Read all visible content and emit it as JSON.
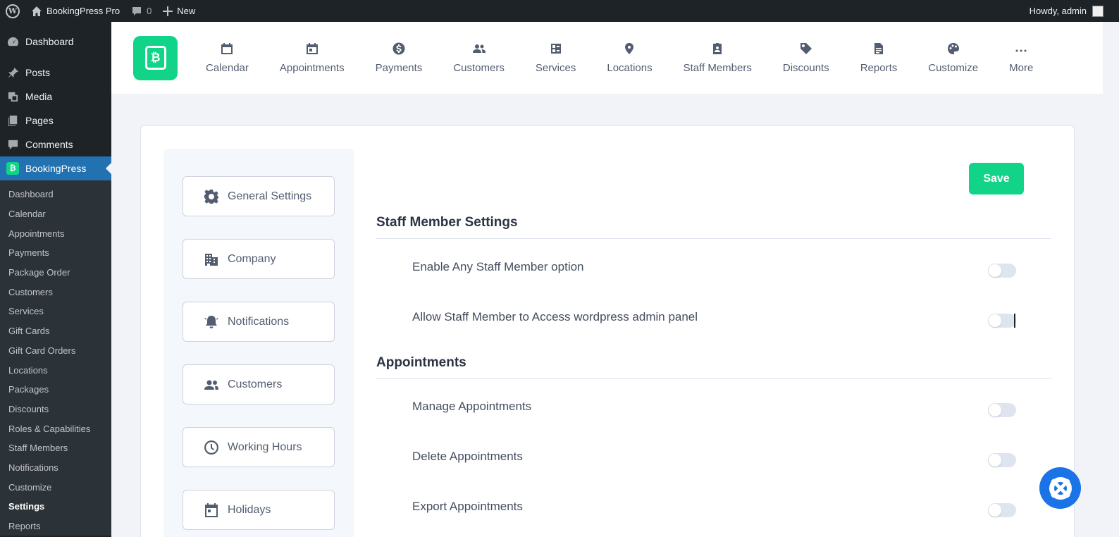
{
  "adminbar": {
    "site_name": "BookingPress Pro",
    "comments_count": "0",
    "new_label": "New",
    "howdy": "Howdy, admin"
  },
  "wp_menu": {
    "top_items": [
      {
        "label": "Dashboard",
        "icon": "dashboard-icon"
      },
      {
        "label": "Posts",
        "icon": "pin-icon"
      },
      {
        "label": "Media",
        "icon": "media-icon"
      },
      {
        "label": "Pages",
        "icon": "pages-icon"
      },
      {
        "label": "Comments",
        "icon": "comment-icon"
      }
    ],
    "current": {
      "label": "BookingPress",
      "icon": "bookingpress-icon"
    },
    "sub_items": [
      "Dashboard",
      "Calendar",
      "Appointments",
      "Payments",
      "Package Order",
      "Customers",
      "Services",
      "Gift Cards",
      "Gift Card Orders",
      "Locations",
      "Packages",
      "Discounts",
      "Roles & Capabilities",
      "Staff Members",
      "Notifications",
      "Customize",
      "Settings",
      "Reports"
    ],
    "active_sub": "Settings"
  },
  "bp_nav": {
    "items": [
      {
        "label": "Calendar",
        "icon": "calendar-icon"
      },
      {
        "label": "Appointments",
        "icon": "appointments-icon"
      },
      {
        "label": "Payments",
        "icon": "dollar-icon"
      },
      {
        "label": "Customers",
        "icon": "users-icon"
      },
      {
        "label": "Services",
        "icon": "services-icon"
      },
      {
        "label": "Locations",
        "icon": "location-pin-icon"
      },
      {
        "label": "Staff Members",
        "icon": "staff-badge-icon"
      },
      {
        "label": "Discounts",
        "icon": "tag-icon"
      },
      {
        "label": "Reports",
        "icon": "report-icon"
      },
      {
        "label": "Customize",
        "icon": "palette-icon"
      },
      {
        "label": "More",
        "icon": "more-dots-icon"
      }
    ]
  },
  "settings_menu": {
    "items": [
      {
        "label": "General Settings",
        "icon": "gear-icon"
      },
      {
        "label": "Company",
        "icon": "building-icon"
      },
      {
        "label": "Notifications",
        "icon": "bell-icon"
      },
      {
        "label": "Customers",
        "icon": "users-icon"
      },
      {
        "label": "Working Hours",
        "icon": "clock-icon"
      },
      {
        "label": "Holidays",
        "icon": "calendar-icon"
      }
    ]
  },
  "content": {
    "save_label": "Save",
    "sections": [
      {
        "title": "Staff Member Settings",
        "settings": [
          {
            "label": "Enable Any Staff Member option",
            "enabled": false
          },
          {
            "label": "Allow Staff Member to Access wordpress admin panel",
            "enabled": false
          }
        ]
      },
      {
        "title": "Appointments",
        "settings": [
          {
            "label": "Manage Appointments",
            "enabled": false
          },
          {
            "label": "Delete Appointments",
            "enabled": false
          },
          {
            "label": "Export Appointments",
            "enabled": false
          }
        ]
      }
    ]
  },
  "colors": {
    "brand_green": "#12d488",
    "wp_dark": "#1d2327",
    "wp_blue": "#2271b1",
    "help_blue": "#1b73e8"
  }
}
